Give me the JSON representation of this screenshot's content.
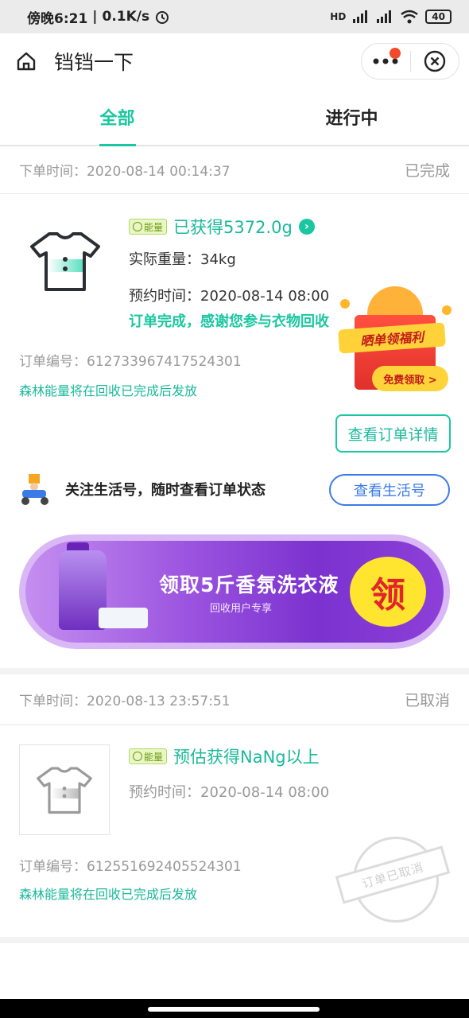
{
  "status_bar": {
    "time": "傍晚6:21",
    "speed": "0.1K/s",
    "network": "HD",
    "battery": "40"
  },
  "nav": {
    "title": "铛铛一下"
  },
  "tabs": [
    {
      "label": "全部",
      "active": true
    },
    {
      "label": "进行中",
      "active": false
    }
  ],
  "orders": [
    {
      "order_time_label": "下单时间：",
      "order_time": "2020-08-14 00:14:37",
      "status": "已完成",
      "energy_badge": "能量",
      "energy_text": "已获得5372.0g",
      "weight_label": "实际重量：",
      "weight": "34kg",
      "appointment_label": "预约时间：",
      "appointment": "2020-08-14 08:00",
      "done_message": "订单完成，感谢您参与衣物回收",
      "order_no_label": "订单编号：",
      "order_no": "612733967417524301",
      "energy_note": "森林能量将在回收已完成后发放",
      "detail_button": "查看订单详情"
    },
    {
      "order_time_label": "下单时间：",
      "order_time": "2020-08-13 23:57:51",
      "status": "已取消",
      "energy_badge": "能量",
      "energy_text": "预估获得NaNg以上",
      "appointment_label": "预约时间：",
      "appointment": "2020-08-14 08:00",
      "order_no_label": "订单编号：",
      "order_no": "612551692405524301",
      "energy_note": "森林能量将在回收已完成后发放",
      "stamp_text": "订单已取消"
    }
  ],
  "follow": {
    "text": "关注生活号，随时查看订单状态",
    "button": "查看生活号"
  },
  "promo": {
    "title": "领取5斤香氛洗衣液",
    "subtitle": "回收用户专享",
    "badge": "领"
  },
  "gift": {
    "ribbon": "晒单领福利",
    "button": "免费领取 >"
  },
  "colors": {
    "accent": "#1bc7a1",
    "link_blue": "#3b7be8",
    "promo_purple": "#7b32cf"
  }
}
